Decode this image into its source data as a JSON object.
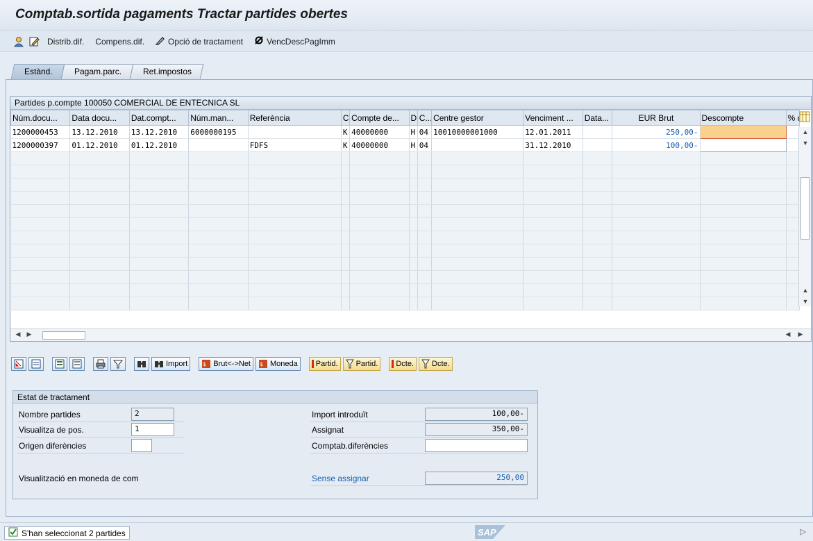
{
  "window": {
    "title": "Comptab.sortida pagaments Tractar partides obertes"
  },
  "toolbar": {
    "items": [
      {
        "label": "Distrib.dif."
      },
      {
        "label": "Compens.dif."
      },
      {
        "label": "Opció de tractament"
      },
      {
        "label": "VencDescPagImm"
      }
    ]
  },
  "tabs": [
    "Estànd.",
    "Pagam.parc.",
    "Ret.impostos"
  ],
  "grid": {
    "title": "Partides p.compte 100050 COMERCIAL DE ENTECNICA SL",
    "columns": [
      "Núm.docu...",
      "Data docu...",
      "Dat.compt...",
      "Núm.man...",
      "Referència",
      "C",
      "Compte de...",
      "D",
      "C...",
      "Centre gestor",
      "Venciment ...",
      "Data...",
      "EUR Brut",
      "Descompte",
      "% d"
    ],
    "rows": [
      [
        "1200000453",
        "13.12.2010",
        "13.12.2010",
        "6000000195",
        "",
        "K",
        "40000000",
        "H",
        "04",
        "10010000001000",
        "12.01.2011",
        "",
        "250,00-",
        "",
        ""
      ],
      [
        "1200000397",
        "01.12.2010",
        "01.12.2010",
        "",
        "FDFS",
        "K",
        "40000000",
        "H",
        "04",
        "",
        "31.12.2010",
        "",
        "100,00-",
        "",
        ""
      ]
    ]
  },
  "buttons": {
    "import": "Import",
    "brut_net": "Brut<->Net",
    "moneda": "Moneda",
    "partid1": "Partid.",
    "partid2": "Partid.",
    "dcte1": "Dcte.",
    "dcte2": "Dcte."
  },
  "status": {
    "header": "Estat de tractament",
    "nombre_partides_label": "Nombre partides",
    "nombre_partides_value": "2",
    "visualitza_label": "Visualitza de pos.",
    "visualitza_value": "1",
    "origen_label": "Origen diferències",
    "origen_value": "",
    "visualitzacio_label": "Visualització en moneda de com",
    "import_label": "Import introduït",
    "import_value": "100,00-",
    "assignat_label": "Assignat",
    "assignat_value": "350,00-",
    "comptab_label": "Comptab.diferències",
    "comptab_value": "",
    "sense_label": "Sense assignar",
    "sense_value": "250,00"
  },
  "statusbar": {
    "message": "S'han seleccionat 2 partides",
    "logo": "SAP"
  },
  "colors": {
    "accent": "#1a5fb4",
    "focus": "#f9d18a"
  }
}
